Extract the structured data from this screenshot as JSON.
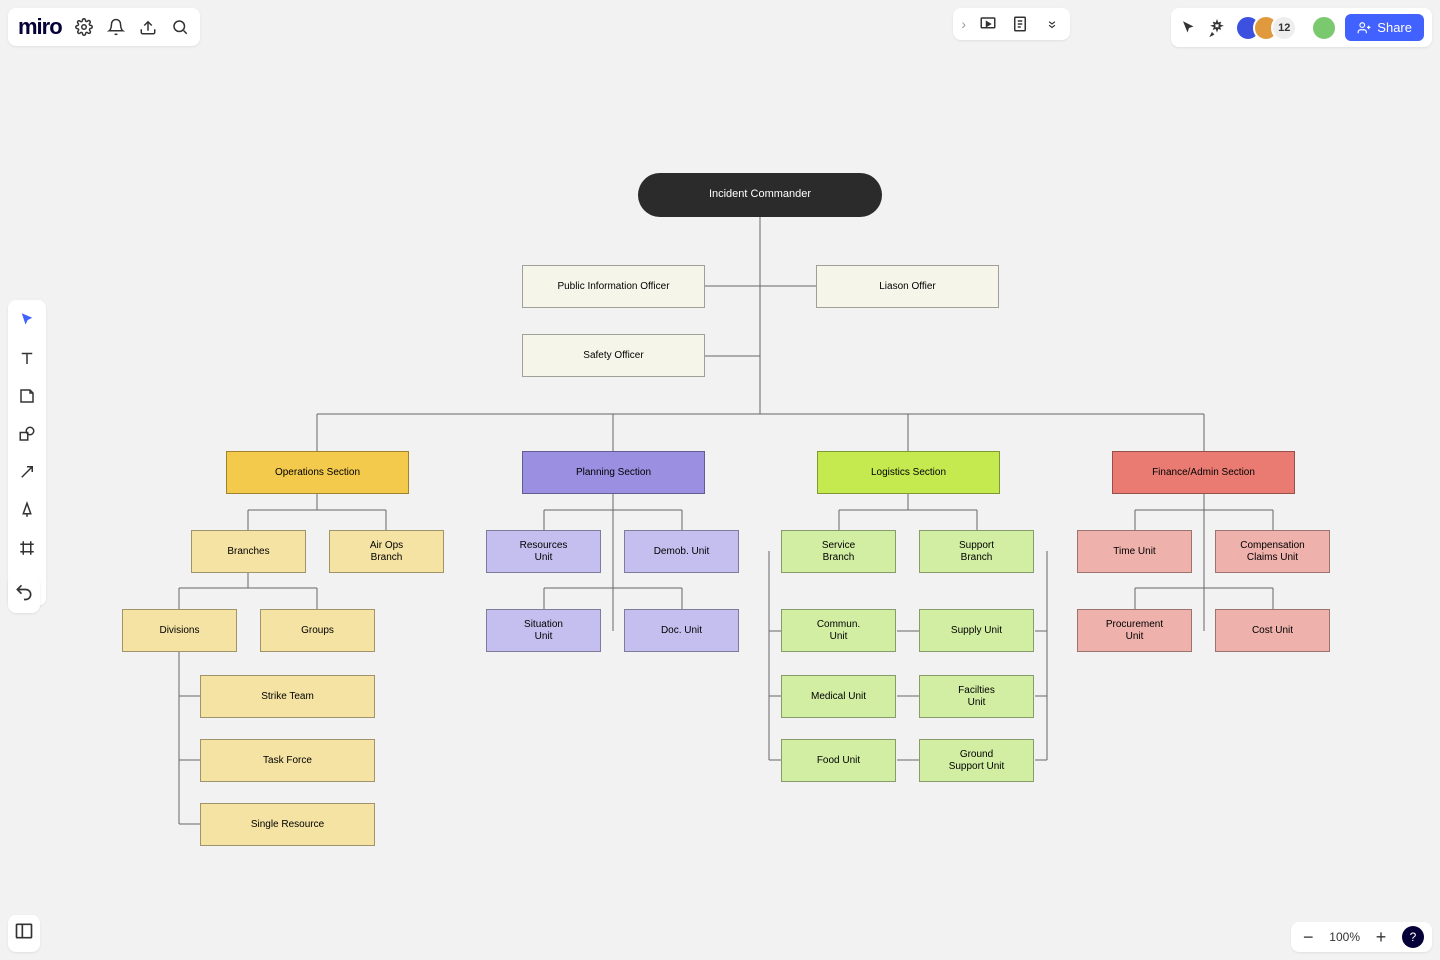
{
  "logo": "miro",
  "participant_count": "12",
  "share_label": "Share",
  "zoom": "100%",
  "help": "?",
  "nodes": {
    "root": "Incident Commander",
    "pio": "Public Information Officer",
    "liason": "Liason Offier",
    "safety": "Safety Officer",
    "ops": "Operations Section",
    "plan": "Planning Section",
    "log": "Logistics Section",
    "fin": "Finance/Admin Section",
    "branches": "Branches",
    "airops": "Air Ops\nBranch",
    "divisions": "Divisions",
    "groups": "Groups",
    "strike": "Strike Team",
    "task": "Task Force",
    "single": "Single Resource",
    "resources": "Resources\nUnit",
    "demob": "Demob. Unit",
    "situation": "Situation\nUnit",
    "doc": "Doc. Unit",
    "service": "Service\nBranch",
    "support": "Support\nBranch",
    "commun": "Commun.\nUnit",
    "supply": "Supply Unit",
    "medical": "Medical Unit",
    "facilities": "Facilties\nUnit",
    "food": "Food Unit",
    "ground": "Ground\nSupport Unit",
    "time": "Time Unit",
    "comp": "Compensation\nClaims Unit",
    "proc": "Procurement\nUnit",
    "cost": "Cost Unit"
  }
}
